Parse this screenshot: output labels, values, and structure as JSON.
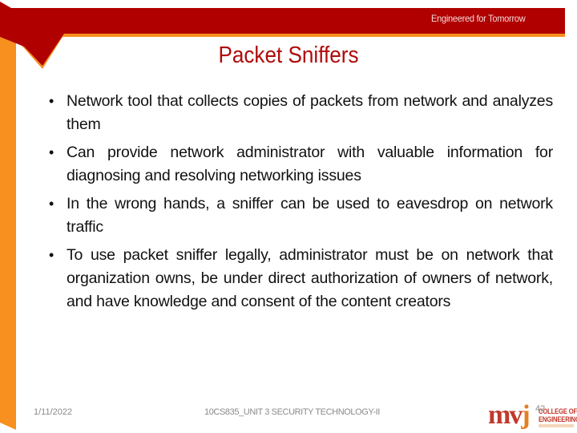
{
  "header": {
    "tagline": "Engineered for Tomorrow",
    "banner_color": "#b00000",
    "accent_color": "#f7901e"
  },
  "slide": {
    "title": "Packet Sniffers",
    "title_color": "#b00b0b",
    "bullets": [
      "Network tool that collects copies of packets from network and analyzes them",
      "Can provide network administrator with valuable information for diagnosing and resolving networking issues",
      "In the wrong hands, a sniffer can be used to eavesdrop on network traffic",
      "To use packet sniffer legally, administrator must be on network that organization owns, be under direct authorization of owners of network, and have knowledge and consent of the content creators"
    ]
  },
  "footer": {
    "date": "1/11/2022",
    "course": "10CS835_UNIT 3 SECURITY TECHNOLOGY-II",
    "page_number": "42",
    "logo": {
      "mark_main": "mv",
      "mark_accent": "j",
      "line1": "COLLEGE OF",
      "line2": "ENGINEERING"
    }
  }
}
